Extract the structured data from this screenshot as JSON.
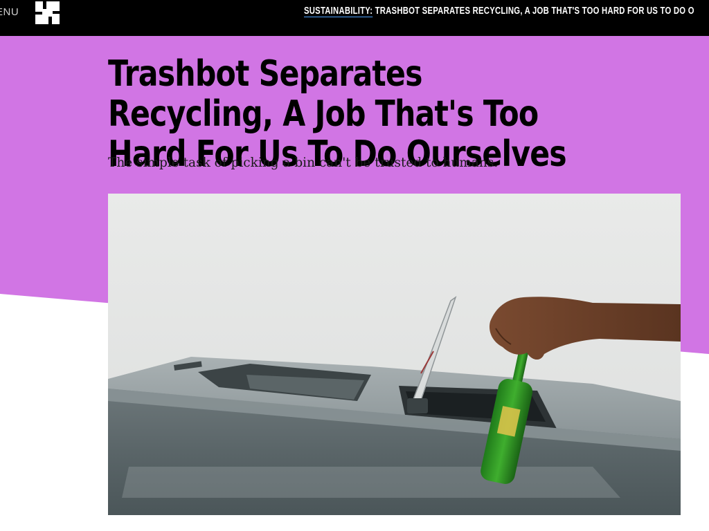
{
  "nav": {
    "menu_label": "ENU",
    "logo_icon": "site-logo-icon",
    "ticker": {
      "kicker": "SUSTAINABILITY:",
      "headline": " TRASHBOT SEPARATES RECYCLING, A JOB THAT'S TOO HARD FOR US TO DO O"
    }
  },
  "article": {
    "headline": "Trashbot Separates Recycling, A Job That's Too Hard For Us To Do Ourselves",
    "dek": "The simple task of picking a bin can't be trusted to humans."
  },
  "colors": {
    "accent_purple": "#d175e4",
    "topbar": "#000000",
    "link_underline": "#4ea3ff"
  }
}
